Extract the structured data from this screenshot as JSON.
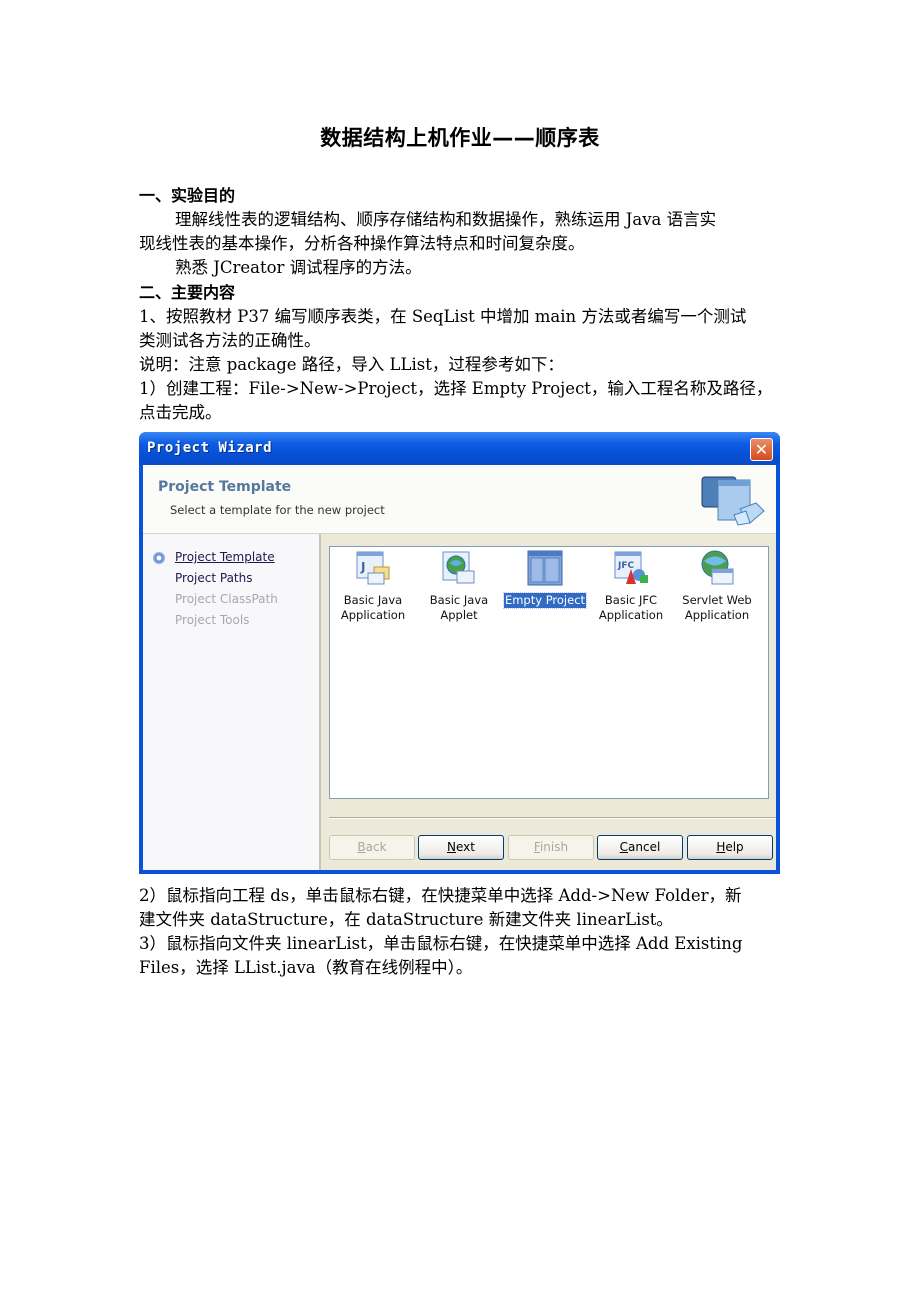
{
  "document": {
    "title": "数据结构上机作业——顺序表",
    "section1_heading": "一、实验目的",
    "section1_p1_line1": "理解线性表的逻辑结构、顺序存储结构和数据操作，熟练运用 Java 语言实",
    "section1_p1_line2": "现线性表的基本操作，分析各种操作算法特点和时间复杂度。",
    "section1_p2": "熟悉 JCreator 调试程序的方法。",
    "section2_heading": "二、主要内容",
    "item1_line1": "1、按照教材 P37 编写顺序表类，在 SeqList 中增加 main 方法或者编写一个测试",
    "item1_line2": "类测试各方法的正确性。",
    "note": "说明：注意 package 路径，导入 LList，过程参考如下：",
    "step1_line1": "1）创建工程：File->New->Project，选择 Empty Project，输入工程名称及路径，",
    "step1_line2": "点击完成。",
    "step2_line1": "2）鼠标指向工程 ds，单击鼠标右键，在快捷菜单中选择 Add->New Folder，新",
    "step2_line2": "建文件夹 dataStructure，在 dataStructure 新建文件夹 linearList。",
    "step3_line1": "3）鼠标指向文件夹 linearList，单击鼠标右键，在快捷菜单中选择 Add Existing",
    "step3_line2": "Files，选择 LList.java（教育在线例程中）。"
  },
  "dialog": {
    "title": "Project Wizard",
    "close_icon": "close-icon",
    "header_title": "Project Template",
    "header_subtitle": "Select a template for the new project",
    "steps": [
      {
        "label": "Project Template",
        "state": "active"
      },
      {
        "label": "Project Paths",
        "state": "normal"
      },
      {
        "label": "Project ClassPath",
        "state": "disabled"
      },
      {
        "label": "Project Tools",
        "state": "disabled"
      }
    ],
    "templates": [
      {
        "line1": "Basic Java",
        "line2": "Application",
        "icon": "java-application-icon",
        "selected": false
      },
      {
        "line1": "Basic Java",
        "line2": "Applet",
        "icon": "java-applet-icon",
        "selected": false
      },
      {
        "line1": "Empty Project",
        "line2": "",
        "icon": "empty-project-icon",
        "selected": true
      },
      {
        "line1": "Basic JFC",
        "line2": "Application",
        "icon": "jfc-application-icon",
        "selected": false
      },
      {
        "line1": "Servlet Web",
        "line2": "Application",
        "icon": "servlet-web-icon",
        "selected": false
      }
    ],
    "buttons": {
      "back": {
        "mnemonic": "B",
        "rest": "ack",
        "enabled": false
      },
      "next": {
        "mnemonic": "N",
        "rest": "ext",
        "enabled": true
      },
      "finish": {
        "mnemonic": "F",
        "rest": "inish",
        "enabled": false
      },
      "cancel": {
        "mnemonic": "C",
        "rest": "ancel",
        "enabled": true
      },
      "help": {
        "mnemonic": "H",
        "rest": "elp",
        "enabled": true
      }
    }
  }
}
